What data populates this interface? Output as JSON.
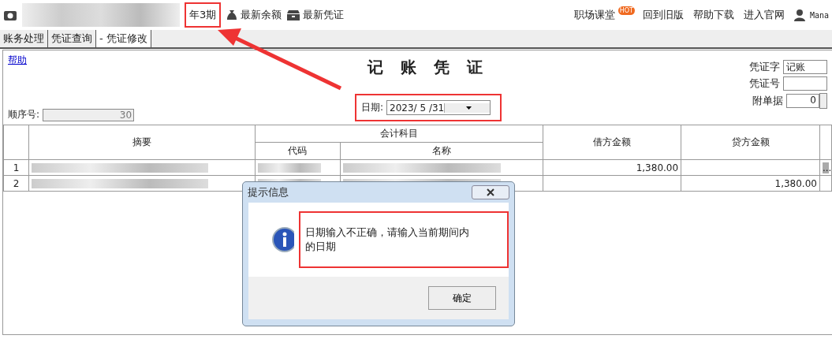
{
  "toolbar": {
    "period": "年3期",
    "actions": [
      {
        "label": "最新余额"
      },
      {
        "label": "最新凭证"
      }
    ],
    "links": [
      {
        "label": "职场课堂",
        "badge": "HOT"
      },
      {
        "label": "回到旧版"
      },
      {
        "label": "帮助下载"
      },
      {
        "label": "进入官网"
      }
    ],
    "user": "Mana"
  },
  "tabs": [
    {
      "label": "账务处理",
      "selected": false
    },
    {
      "label": "凭证查询",
      "selected": false
    },
    {
      "label": "- 凭证修改",
      "selected": true
    }
  ],
  "voucher": {
    "help_link": "帮助",
    "title": "记账凭证",
    "sequence_label": "顺序号:",
    "sequence_value": "30",
    "date_label": "日期:",
    "date_value": "2023/ 5 /31",
    "type_label": "凭证字",
    "type_value": "记账",
    "number_label": "凭证号",
    "attachments_label": "附单据",
    "attachments_value": "0"
  },
  "table": {
    "columns": {
      "summary": "摘要",
      "account": "会计科目",
      "code": "代码",
      "name": "名称",
      "debit": "借方金额",
      "credit": "贷方金额"
    },
    "rows": [
      {
        "index": "1",
        "debit": "1,380.00",
        "more": "..."
      },
      {
        "index": "2",
        "credit": "1,380.00"
      }
    ]
  },
  "dialog": {
    "title": "提示信息",
    "message": "日期输入不正确，请输入当前期间内的日期",
    "button": "确定"
  }
}
